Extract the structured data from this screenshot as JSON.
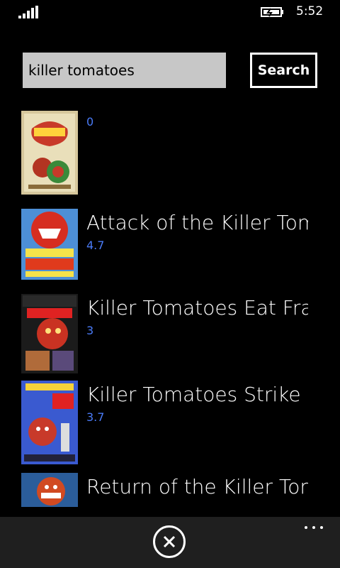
{
  "status_bar": {
    "time": "5:52",
    "signal_icon": "signal-strength-icon",
    "battery_icon": "battery-charging-icon"
  },
  "search": {
    "query": "killer tomatoes",
    "button_label": "Search"
  },
  "results": [
    {
      "title": "",
      "rating": "0",
      "poster_icon": "movie-poster-1"
    },
    {
      "title": "Attack of the Killer Tom",
      "rating": "4.7",
      "poster_icon": "movie-poster-2"
    },
    {
      "title": "Killer Tomatoes Eat Fra",
      "rating": "3",
      "poster_icon": "movie-poster-3"
    },
    {
      "title": "Killer Tomatoes Strike B",
      "rating": "3.7",
      "poster_icon": "movie-poster-4"
    },
    {
      "title": "Return of the Killer Tom",
      "rating": "",
      "poster_icon": "movie-poster-5"
    }
  ],
  "app_bar": {
    "close_icon": "close-icon",
    "more_icon": "more-options-icon"
  },
  "colors": {
    "rating": "#4a7bf7",
    "input_bg": "#c7c7c7",
    "appbar_bg": "#1f1f1f"
  }
}
